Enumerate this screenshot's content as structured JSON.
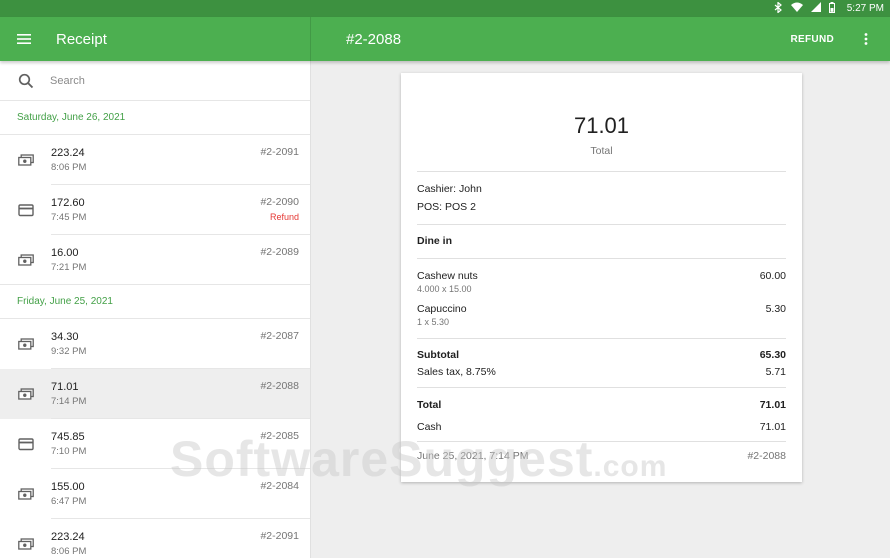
{
  "status_bar": {
    "time": "5:27 PM",
    "icons": [
      "bluetooth-icon",
      "wifi-icon",
      "signal-icon",
      "battery-icon"
    ]
  },
  "app_bar": {
    "title": "Receipt",
    "receipt_number": "#2-2088",
    "refund_label": "REFUND"
  },
  "search": {
    "placeholder": "Search"
  },
  "groups": [
    {
      "date": "Saturday, June 26, 2021",
      "items": [
        {
          "amount": "223.24",
          "time": "8:06 PM",
          "number": "#2-2091",
          "status": "",
          "icon": "cash-icon"
        },
        {
          "amount": "172.60",
          "time": "7:45 PM",
          "number": "#2-2090",
          "status": "Refund",
          "icon": "card-icon"
        },
        {
          "amount": "16.00",
          "time": "7:21 PM",
          "number": "#2-2089",
          "status": "",
          "icon": "cash-icon"
        }
      ]
    },
    {
      "date": "Friday, June 25, 2021",
      "items": [
        {
          "amount": "34.30",
          "time": "9:32 PM",
          "number": "#2-2087",
          "status": "",
          "icon": "cash-icon"
        },
        {
          "amount": "71.01",
          "time": "7:14 PM",
          "number": "#2-2088",
          "status": "",
          "icon": "cash-icon",
          "selected": true
        },
        {
          "amount": "745.85",
          "time": "7:10 PM",
          "number": "#2-2085",
          "status": "",
          "icon": "card-icon"
        },
        {
          "amount": "155.00",
          "time": "6:47 PM",
          "number": "#2-2084",
          "status": "",
          "icon": "cash-icon"
        },
        {
          "amount": "223.24",
          "time": "8:06 PM",
          "number": "#2-2091",
          "status": "",
          "icon": "cash-icon"
        }
      ]
    }
  ],
  "receipt": {
    "total_amount": "71.01",
    "total_label": "Total",
    "cashier": "Cashier: John",
    "pos": "POS: POS 2",
    "dining_option": "Dine in",
    "items": [
      {
        "name": "Cashew nuts",
        "detail": "4.000 x 15.00",
        "price": "60.00"
      },
      {
        "name": "Capuccino",
        "detail": "1 x 5.30",
        "price": "5.30"
      }
    ],
    "subtotal_label": "Subtotal",
    "subtotal_value": "65.30",
    "tax_label": "Sales tax, 8.75%",
    "tax_value": "5.71",
    "total_row_label": "Total",
    "total_row_value": "71.01",
    "payment_label": "Cash",
    "payment_value": "71.01",
    "datetime": "June 25, 2021, 7:14 PM",
    "number": "#2-2088"
  },
  "watermark": {
    "main": "SoftwareSuggest",
    "suffix": ".com"
  },
  "colors": {
    "status_bar": "#3d9140",
    "app_bar": "#4caf50",
    "date_header": "#43a047",
    "refund": "#e53935"
  }
}
